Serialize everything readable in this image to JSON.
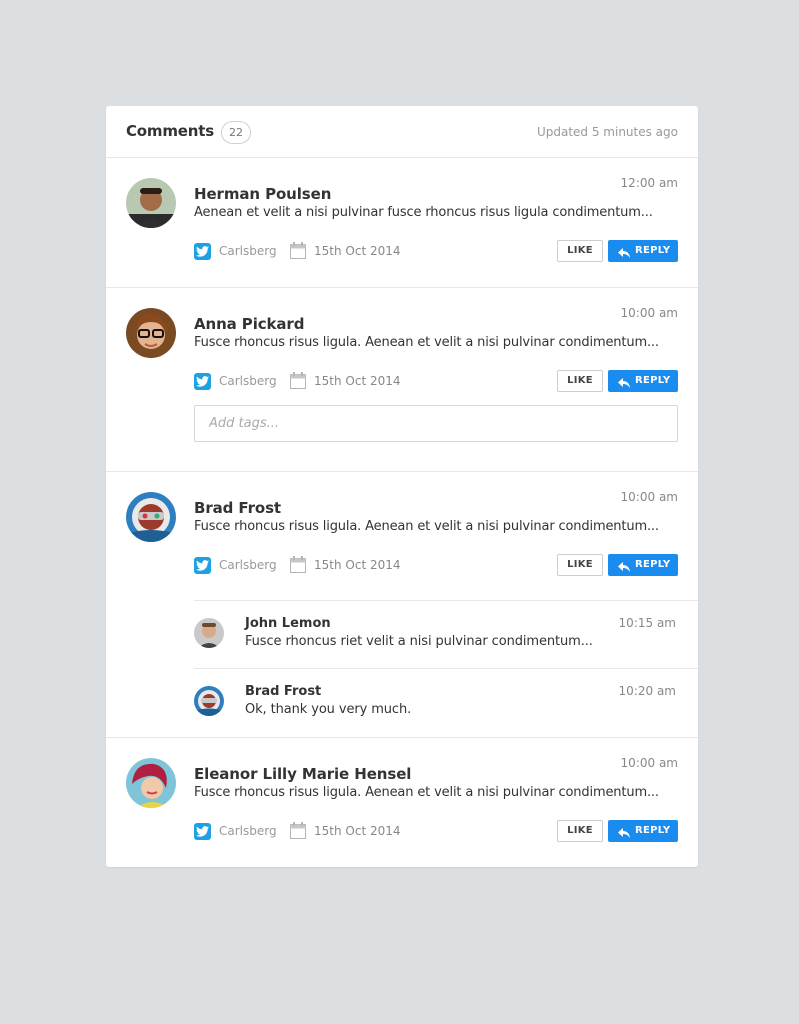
{
  "header": {
    "title": "Comments",
    "count": "22",
    "updated": "Updated 5 minutes ago"
  },
  "actions": {
    "like_label": "LIKE",
    "reply_label": "REPLY"
  },
  "tag_input": {
    "placeholder": "Add tags..."
  },
  "comments": [
    {
      "name": "Herman Poulsen",
      "time": "12:00 am",
      "text": "Aenean et velit a nisi pulvinar fusce rhoncus risus ligula condimentum...",
      "source": "Carlsberg",
      "date": "15th Oct 2014"
    },
    {
      "name": "Anna Pickard",
      "time": "10:00 am",
      "text": "Fusce rhoncus risus ligula. Aenean et velit a nisi pulvinar condimentum...",
      "source": "Carlsberg",
      "date": "15th Oct 2014"
    },
    {
      "name": "Brad Frost",
      "time": "10:00 am",
      "text": "Fusce rhoncus risus ligula. Aenean et velit a nisi pulvinar condimentum...",
      "source": "Carlsberg",
      "date": "15th Oct 2014",
      "replies": [
        {
          "name": "John Lemon",
          "time": "10:15 am",
          "text": "Fusce rhoncus riet velit a nisi pulvinar condimentum..."
        },
        {
          "name": "Brad Frost",
          "time": "10:20 am",
          "text": "Ok, thank you very much."
        }
      ]
    },
    {
      "name": "Eleanor Lilly Marie Hensel",
      "time": "10:00 am",
      "text": "Fusce rhoncus risus ligula. Aenean et velit a nisi pulvinar condimentum...",
      "source": "Carlsberg",
      "date": "15th Oct 2014"
    }
  ],
  "colors": {
    "background": "#dcdfe2",
    "accent": "#1a8cf0",
    "twitter": "#1da1e2"
  }
}
